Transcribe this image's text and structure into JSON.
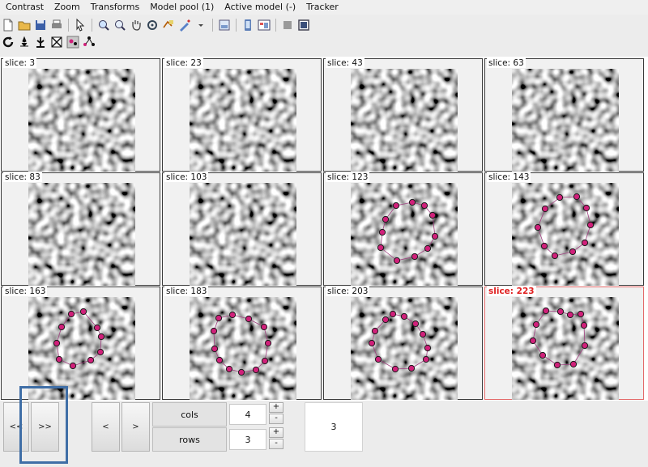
{
  "menu": [
    "Contrast",
    "Zoom",
    "Transforms",
    "Model pool (1)",
    "Active model (-)",
    "Tracker"
  ],
  "toolbar1": [
    "new-file-icon",
    "open-folder-icon",
    "save-icon",
    "print-icon",
    "|",
    "pointer-icon",
    "|",
    "zoom-in-icon",
    "zoom-out-icon",
    "pan-hand-icon",
    "rotate-icon",
    "model-add-icon",
    "paint-tool-icon",
    "dropdown-arrow-icon",
    "|",
    "tree-view-icon",
    "|",
    "phone-view-icon",
    "window-view-icon",
    "|",
    "gray-square-icon",
    "frame-square-icon"
  ],
  "toolbar2": [
    "refresh-icon",
    "map-tool-icon",
    "plant-tool-icon",
    "grid-tool-icon",
    "point-tool-icon",
    "points-cycle-icon"
  ],
  "slices": [
    {
      "label": "slice: 3",
      "points": []
    },
    {
      "label": "slice: 23",
      "points": []
    },
    {
      "label": "slice: 43",
      "points": []
    },
    {
      "label": "slice: 63",
      "points": []
    },
    {
      "label": "slice: 83",
      "points": []
    },
    {
      "label": "slice: 103",
      "points": []
    },
    {
      "label": "slice: 123",
      "points": [
        [
          56,
          28
        ],
        [
          76,
          24
        ],
        [
          91,
          28
        ],
        [
          101,
          40
        ],
        [
          104,
          66
        ],
        [
          95,
          81
        ],
        [
          79,
          91
        ],
        [
          57,
          96
        ],
        [
          37,
          80
        ],
        [
          39,
          61
        ],
        [
          43,
          45
        ]
      ]
    },
    {
      "label": "slice: 143",
      "points": [
        [
          59,
          18
        ],
        [
          80,
          17
        ],
        [
          92,
          31
        ],
        [
          97,
          52
        ],
        [
          90,
          74
        ],
        [
          75,
          85
        ],
        [
          53,
          90
        ],
        [
          40,
          78
        ],
        [
          32,
          55
        ],
        [
          41,
          32
        ]
      ]
    },
    {
      "label": "slice: 163",
      "points": [
        [
          53,
          21
        ],
        [
          68,
          18
        ],
        [
          85,
          38
        ],
        [
          90,
          49
        ],
        [
          89,
          68
        ],
        [
          77,
          78
        ],
        [
          55,
          85
        ],
        [
          38,
          77
        ],
        [
          35,
          57
        ],
        [
          41,
          37
        ]
      ]
    },
    {
      "label": "slice: 183",
      "points": [
        [
          53,
          22
        ],
        [
          73,
          27
        ],
        [
          92,
          37
        ],
        [
          97,
          57
        ],
        [
          93,
          79
        ],
        [
          82,
          90
        ],
        [
          64,
          93
        ],
        [
          49,
          89
        ],
        [
          37,
          78
        ],
        [
          31,
          64
        ],
        [
          30,
          42
        ],
        [
          36,
          26
        ]
      ]
    },
    {
      "label": "slice: 203",
      "points": [
        [
          52,
          21
        ],
        [
          66,
          24
        ],
        [
          80,
          33
        ],
        [
          89,
          46
        ],
        [
          95,
          63
        ],
        [
          93,
          77
        ],
        [
          75,
          88
        ],
        [
          55,
          89
        ],
        [
          34,
          77
        ],
        [
          26,
          57
        ],
        [
          30,
          42
        ],
        [
          43,
          28
        ]
      ]
    },
    {
      "label": "slice: 223",
      "points": [
        [
          42,
          17
        ],
        [
          60,
          18
        ],
        [
          72,
          22
        ],
        [
          85,
          21
        ],
        [
          89,
          35
        ],
        [
          90,
          60
        ],
        [
          76,
          83
        ],
        [
          56,
          84
        ],
        [
          38,
          72
        ],
        [
          26,
          54
        ],
        [
          30,
          34
        ]
      ]
    }
  ],
  "selected_index": 11,
  "controls": {
    "first_label": "<<",
    "next_label": ">>",
    "prev_label": "<",
    "forward_label": ">",
    "cols_label": "cols",
    "cols_value": "4",
    "rows_label": "rows",
    "rows_value": "3",
    "plus_label": "+",
    "minus_label": "-",
    "count_value": "3"
  },
  "colors": {
    "marker": "#d0207a",
    "selected_border": "#e36a6a",
    "highlight": "#3f6ea6"
  }
}
